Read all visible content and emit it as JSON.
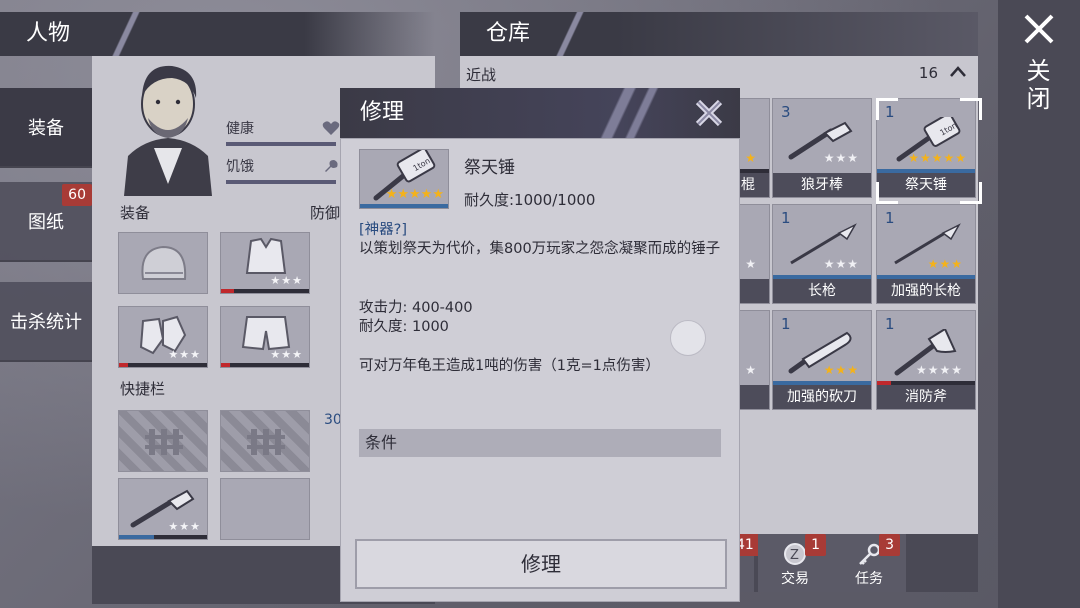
{
  "left_panel": {
    "title": "人物",
    "tabs": [
      {
        "label": "装备"
      },
      {
        "label": "图纸",
        "badge": "60"
      },
      {
        "label": "击杀统计"
      }
    ],
    "stats": [
      {
        "label": "健康"
      },
      {
        "label": "饥饿"
      }
    ],
    "equipment_label": "装备",
    "defense_label": "防御",
    "quickbar_label": "快捷栏",
    "quickbar_count_partial": "30"
  },
  "inventory": {
    "title": "仓库",
    "category": "近战",
    "count": "16",
    "items": [
      {
        "name": "狼牙棒",
        "qty": "3",
        "stars": 3,
        "rating_color": "#f0f0f4",
        "icon": "spiked-club-icon"
      },
      {
        "name": "祭天锤",
        "qty": "1",
        "stars": 5,
        "rating_color": "#f4b21a",
        "icon": "hammer-icon",
        "selected": true
      },
      {
        "name": "长枪",
        "qty": "1",
        "stars": 3,
        "rating_color": "#f0f0f4",
        "icon": "spear-icon"
      },
      {
        "name": "加强的长枪",
        "qty": "1",
        "stars": 3,
        "rating_color": "#f4b21a",
        "icon": "spear-icon"
      },
      {
        "name": "加强的砍刀",
        "qty": "1",
        "stars": 3,
        "rating_color": "#f4b21a",
        "icon": "machete-icon"
      },
      {
        "name": "消防斧",
        "qty": "1",
        "stars": 4,
        "rating_color": "#f0f0f4",
        "icon": "fire-axe-icon"
      }
    ],
    "partial_labels": [
      "棍"
    ],
    "bottom_buttons": [
      {
        "label": "交易",
        "badge": "1",
        "icon": "coin-icon"
      },
      {
        "label": "任务",
        "badge": "3",
        "icon": "key-icon"
      }
    ],
    "partial_badge": "41"
  },
  "close_label": "关闭",
  "modal": {
    "title": "修理",
    "item_name": "祭天锤",
    "durability": "耐久度:1000/1000",
    "tag": "[神器?]",
    "description": "以策划祭天为代价，集800万玩家之怨念凝聚而成的锤子",
    "attack": "攻击力: 400-400",
    "durability_stat": "耐久度: 1000",
    "effect": "可对万年龟王造成1吨的伤害（1克=1点伤害）",
    "condition_label": "条件",
    "repair_button": "修理"
  }
}
